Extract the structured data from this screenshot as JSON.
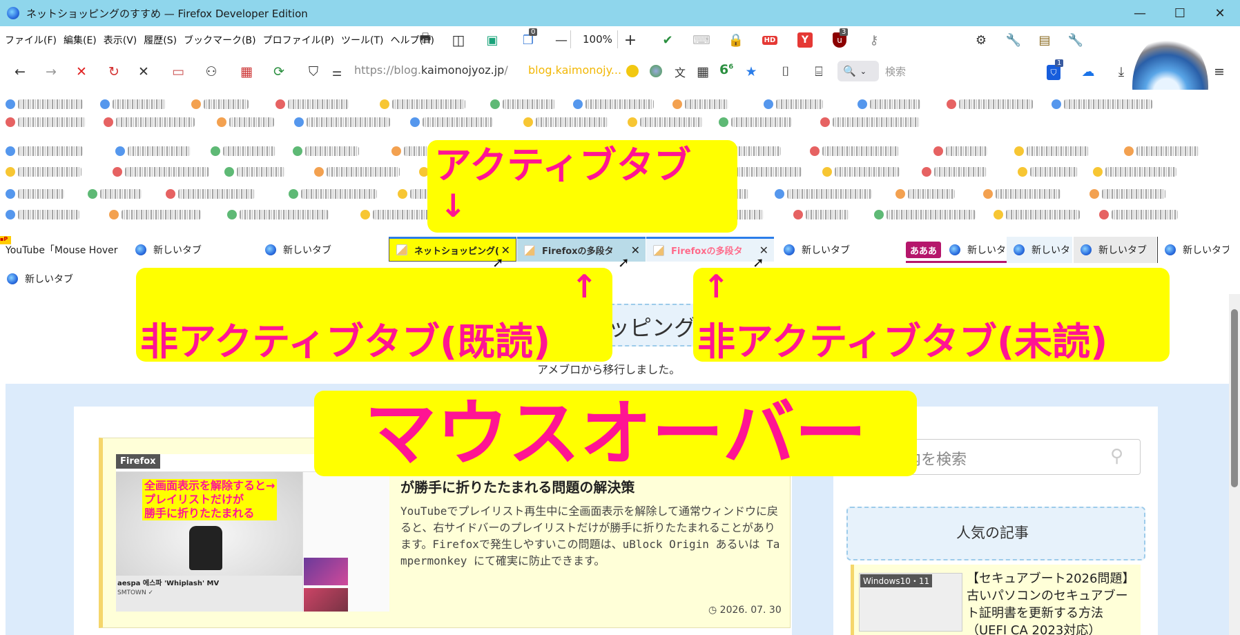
{
  "window": {
    "title": "ネットショッピングのすすめ — Firefox Developer Edition",
    "minimize": "—",
    "maximize": "☐",
    "close": "✕"
  },
  "menu": [
    "ファイル(F)",
    "編集(E)",
    "表示(V)",
    "履歴(S)",
    "ブックマーク(B)",
    "プロファイル(P)",
    "ツール(T)",
    "ヘルプ(H)"
  ],
  "toolbar": {
    "badge_counter": "0",
    "zoom_minus": "—",
    "zoom_level": "100%",
    "zoom_plus": "+",
    "ublock_badge": "3"
  },
  "nav": {
    "url_prefix": "https://blog.",
    "url_domain": "kaimonojyoz.jp",
    "url_suffix": "/",
    "url_secondary": "blog.kaimonojy...",
    "six_label": "6",
    "six_sup": "6",
    "search_placeholder": "検索",
    "bitwarden_badge": "1"
  },
  "tabs": [
    {
      "label": "YouTube「Mouse Hover",
      "state": "normal"
    },
    {
      "label": "新しいタブ",
      "state": "normal"
    },
    {
      "label": "新しいタブ",
      "state": "normal"
    },
    {
      "label": "ネットショッピング(",
      "state": "active"
    },
    {
      "label": "Firefoxの多段タ",
      "state": "hover-read"
    },
    {
      "label": "Firefoxの多段タ",
      "state": "unread"
    },
    {
      "label": "新しいタブ",
      "state": "normal"
    },
    {
      "label": "あああ",
      "state": "group"
    },
    {
      "label": "新しいタ",
      "state": "normal"
    },
    {
      "label": "新しいタ",
      "state": "normal"
    },
    {
      "label": "新しいタブ",
      "state": "normal"
    },
    {
      "label": "新しいタブ",
      "state": "normal"
    },
    {
      "label": "新しいタブ",
      "state": "normal"
    }
  ],
  "annotations": {
    "active_tab": "アクティブタブ",
    "active_arrow": "↓",
    "inactive_read": "非アクティブタブ(既読)",
    "inactive_read_arrow": "↑",
    "inactive_unread": "非アクティブタブ(未読)",
    "inactive_unread_arrow": "↑",
    "mouse_over": "マウスオーバー"
  },
  "page": {
    "site_title_fragment": "ッピング",
    "site_subtitle": "アメブロから移行しました。",
    "search_placeholder": "内を検索",
    "popular_title": "人気の記事",
    "article": {
      "title_fragment": "が勝手に折りたたまれる問題の解決策",
      "excerpt": "YouTubeでプレイリスト再生中に全画面表示を解除して通常ウィンドウに戻ると、右サイドバーのプレイリストだけが勝手に折りたたまれることがあります。Firefoxで発生しやすいこの問題は、uBlock Origin あるいは Tampermonkey にて確実に防止できます。",
      "date": "2026. 07. 30",
      "thumb_label": "Firefox",
      "thumb_caption_1": "全画面表示を解除すると→",
      "thumb_caption_2": "プレイリストだけが",
      "thumb_caption_3": "勝手に折りたたまれる",
      "thumb_video_title": "aespa 에스파 'Whiplash' MV",
      "thumb_channel": "SMTOWN ✓"
    },
    "popular_item": {
      "thumb_label": "Windows10・11",
      "title": "【セキュアブート2026問題】古いパソコンのセキュアブート証明書を更新する方法（UEFI CA 2023対応）"
    }
  }
}
